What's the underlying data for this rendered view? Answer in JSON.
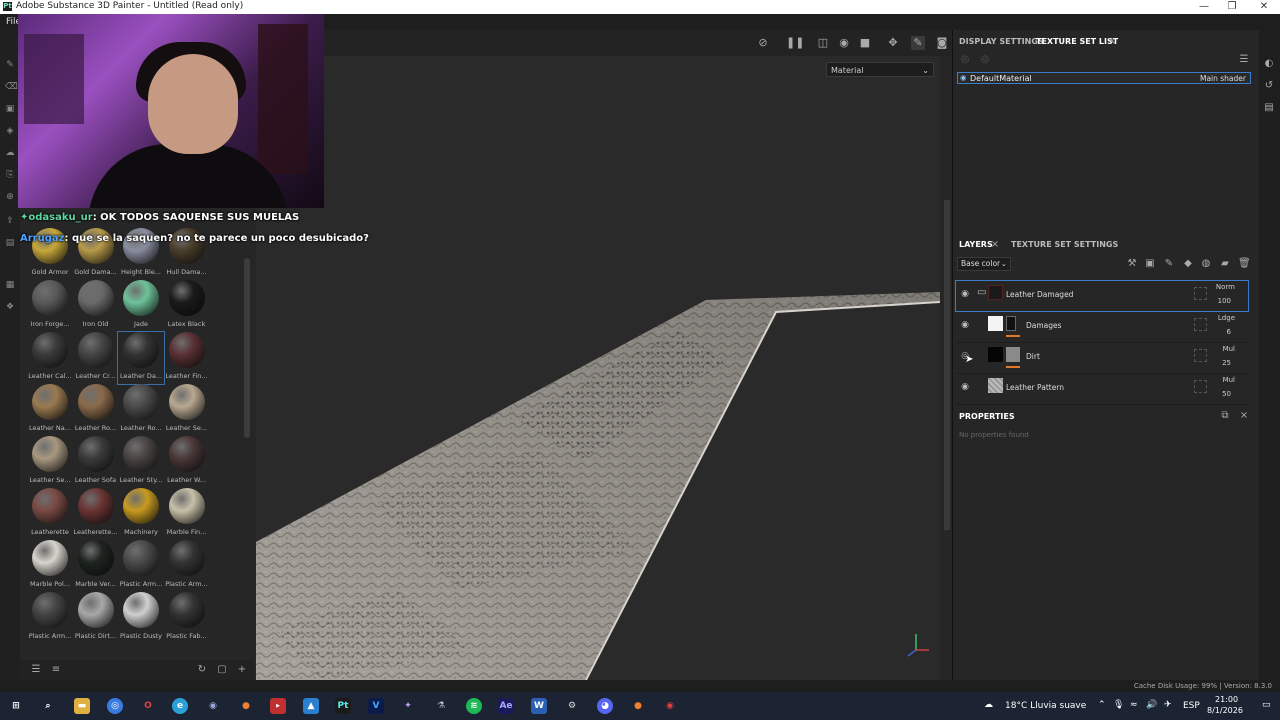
{
  "window": {
    "title": "Adobe Substance 3D Painter - Untitled (Read only)",
    "minimize": "—",
    "restore": "❐",
    "close": "✕"
  },
  "menu": {
    "file": "File"
  },
  "chat": [
    {
      "user": "odasaku_ur",
      "message": "OK TODOS SAQUENSE SUS MUELAS"
    },
    {
      "user": "Arrugaz",
      "message": "que se la saquen? no te parece un poco desubicado?"
    }
  ],
  "materials": [
    {
      "label": "Gold Armor",
      "color": "#c8a83a"
    },
    {
      "label": "Gold Dama...",
      "color": "#b89a48"
    },
    {
      "label": "Height Ble...",
      "color": "#8a8fa0"
    },
    {
      "label": "Hull Dama...",
      "color": "#4a3e2a"
    },
    {
      "label": "Iron Forge...",
      "color": "#5a5a5a"
    },
    {
      "label": "Iron Old",
      "color": "#6a6a6a"
    },
    {
      "label": "Jade",
      "color": "#6ec29a"
    },
    {
      "label": "Latex Black",
      "color": "#1a1a1a"
    },
    {
      "label": "Leather Cal...",
      "color": "#3a3a3a"
    },
    {
      "label": "Leather Cr...",
      "color": "#444444"
    },
    {
      "label": "Leather Da...",
      "color": "#333333",
      "selected": true
    },
    {
      "label": "Leather Fin...",
      "color": "#5a3034"
    },
    {
      "label": "Leather Na...",
      "color": "#9a7a50"
    },
    {
      "label": "Leather Ro...",
      "color": "#8a6a4a"
    },
    {
      "label": "Leather Ro...",
      "color": "#4a4a4a"
    },
    {
      "label": "Leather Se...",
      "color": "#b8a890"
    },
    {
      "label": "Leather Se...",
      "color": "#a89880"
    },
    {
      "label": "Leather Sofa",
      "color": "#3a3a3a"
    },
    {
      "label": "Leather Sty...",
      "color": "#4a4444"
    },
    {
      "label": "Leather W...",
      "color": "#4a3838"
    },
    {
      "label": "Leatherette",
      "color": "#7a4a44"
    },
    {
      "label": "Leatherette...",
      "color": "#6a3434"
    },
    {
      "label": "Machinery",
      "color": "#c89a20"
    },
    {
      "label": "Marble Fin...",
      "color": "#c8c0a8"
    },
    {
      "label": "Marble Pol...",
      "color": "#d8d4cc"
    },
    {
      "label": "Marble Ver...",
      "color": "#1e2420"
    },
    {
      "label": "Plastic Arm...",
      "color": "#4a4a4a"
    },
    {
      "label": "Plastic Arm...",
      "color": "#333333"
    },
    {
      "label": "Plastic Arm...",
      "color": "#444444"
    },
    {
      "label": "Plastic Dirt...",
      "color": "#a8a8a8"
    },
    {
      "label": "Plastic Dusty",
      "color": "#d0d0d0"
    },
    {
      "label": "Plastic Fab...",
      "color": "#333333"
    }
  ],
  "viewport": {
    "material_dropdown": "Material"
  },
  "texture_set": {
    "tabs": [
      "DISPLAY SETTINGS",
      "TEXTURE SET LIST"
    ],
    "name": "DefaultMaterial",
    "shader": "Main shader"
  },
  "layers": {
    "tabs": [
      "LAYERS",
      "TEXTURE SET SETTINGS"
    ],
    "channel": "Base color",
    "items": [
      {
        "name": "Leather Damaged",
        "blend": "Norm",
        "opacity": "100"
      },
      {
        "name": "Damages",
        "blend": "Ldge",
        "opacity": "6"
      },
      {
        "name": "Dirt",
        "blend": "Mul",
        "opacity": "25"
      },
      {
        "name": "Leather Pattern",
        "blend": "Mul",
        "opacity": "50"
      }
    ]
  },
  "properties": {
    "title": "PROPERTIES",
    "empty": "No properties found"
  },
  "status": {
    "cache": "Cache Disk Usage:   99%  |  Version: 8.3.0"
  },
  "taskbar": {
    "weather": "18°C  Lluvia suave",
    "lang": "ESP",
    "time": "21:00",
    "date": "8/1/2026"
  }
}
